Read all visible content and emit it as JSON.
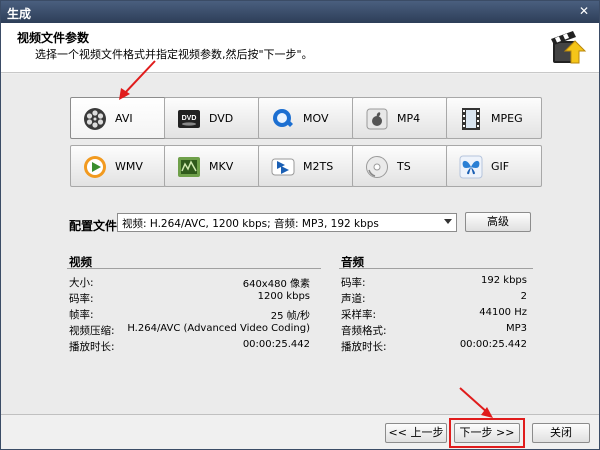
{
  "window": {
    "title": "生成"
  },
  "header": {
    "title": "视频文件参数",
    "subtitle": "选择一个视频文件格式并指定视频参数,然后按\"下一步\"。"
  },
  "formats": [
    {
      "label": "AVI",
      "icon": "film-reel-icon",
      "selected": true
    },
    {
      "label": "DVD",
      "icon": "dvd-icon",
      "selected": false
    },
    {
      "label": "MOV",
      "icon": "quicktime-icon",
      "selected": false
    },
    {
      "label": "MP4",
      "icon": "apple-icon",
      "selected": false
    },
    {
      "label": "MPEG",
      "icon": "film-strip-icon",
      "selected": false
    },
    {
      "label": "WMV",
      "icon": "windows-media-icon",
      "selected": false
    },
    {
      "label": "MKV",
      "icon": "mkv-icon",
      "selected": false
    },
    {
      "label": "M2TS",
      "icon": "bluray-icon",
      "selected": false
    },
    {
      "label": "TS",
      "icon": "disc-icon",
      "selected": false
    },
    {
      "label": "GIF",
      "icon": "butterfly-icon",
      "selected": false
    }
  ],
  "config": {
    "label": "配置文件",
    "value": "视频: H.264/AVC, 1200 kbps; 音频: MP3, 192 kbps",
    "advanced_label": "高级"
  },
  "video": {
    "title": "视频",
    "rows": [
      {
        "label": "大小:",
        "value": "640x480 像素"
      },
      {
        "label": "码率:",
        "value": "1200 kbps"
      },
      {
        "label": "帧率:",
        "value": "25 帧/秒"
      },
      {
        "label": "视频压缩:",
        "value": "H.264/AVC (Advanced Video Coding)"
      },
      {
        "label": "播放时长:",
        "value": "00:00:25.442"
      }
    ]
  },
  "audio": {
    "title": "音频",
    "rows": [
      {
        "label": "码率:",
        "value": "192 kbps"
      },
      {
        "label": "声道:",
        "value": "2"
      },
      {
        "label": "采样率:",
        "value": "44100 Hz"
      },
      {
        "label": "音频格式:",
        "value": "MP3"
      },
      {
        "label": "播放时长:",
        "value": "00:00:25.442"
      }
    ]
  },
  "footer": {
    "back_label": "<< 上一步",
    "next_label": "下一步 >>",
    "close_label": "关闭"
  },
  "colors": {
    "highlight": "#e01c1c",
    "titlebar": "#2d3e58"
  }
}
